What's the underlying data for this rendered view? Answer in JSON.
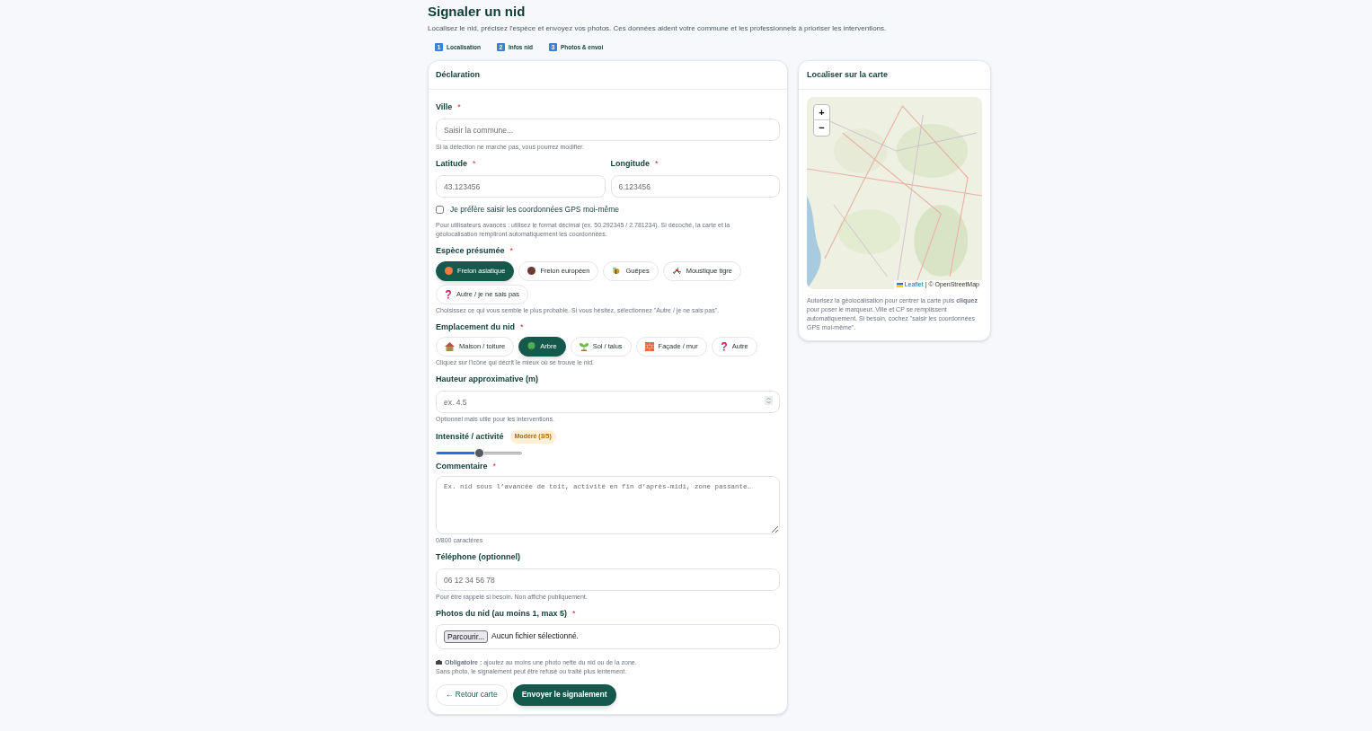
{
  "page": {
    "title": "Signaler un nid",
    "subtitle": "Localisez le nid, précisez l'espèce et envoyez vos photos. Ces données aident votre commune et les professionnels à prioriser les interventions."
  },
  "steps": [
    {
      "number": "1",
      "label": "Localisation"
    },
    {
      "number": "2",
      "label": "Infos nid"
    },
    {
      "number": "3",
      "label": "Photos & envoi"
    }
  ],
  "form": {
    "title": "Déclaration",
    "fields": [
      {
        "kind": "text",
        "label": "Ville",
        "required_mark": "*",
        "placeholder": "Saisir la commune...",
        "hint": "Si la détection ne marche pas, vous pourrez modifier."
      },
      {
        "kind": "pair",
        "fields": [
          {
            "label": "Latitude",
            "required_mark": "*",
            "placeholder": "43.123456"
          },
          {
            "label": "Longitude",
            "required_mark": "*",
            "placeholder": "6.123456"
          }
        ]
      },
      {
        "kind": "checkbox",
        "label": "Je préfère saisir les coordonnées GPS moi-même",
        "checked": false,
        "hint": "Pour utilisateurs avancés : utilisez le format décimal (ex. 50.292345 / 2.781234). Si décoché, la carte et la géolocalisation rempliront automatiquement les coordonnées."
      },
      {
        "kind": "chips",
        "label": "Espèce présumée",
        "required_mark": "*",
        "options": [
          {
            "label": "Frelon asiatique",
            "selected": true
          },
          {
            "label": "Frelon européen",
            "selected": false
          },
          {
            "label": "Guêpes",
            "selected": false
          },
          {
            "label": "Moustique tigre",
            "selected": false
          },
          {
            "label": "Autre / je ne sais pas",
            "selected": false
          }
        ],
        "hint": "Choisissez ce qui vous semble le plus probable. Si vous hésitez, sélectionnez \"Autre / je ne sais pas\"."
      },
      {
        "kind": "chips",
        "label": "Emplacement du nid",
        "required_mark": "*",
        "options": [
          {
            "label": "Maison / toiture",
            "selected": false
          },
          {
            "label": "Arbre",
            "selected": true
          },
          {
            "label": "Sol / talus",
            "selected": false
          },
          {
            "label": "Façade / mur",
            "selected": false
          },
          {
            "label": "Autre",
            "selected": false
          }
        ],
        "hint": "Cliquez sur l'icône qui décrit le mieux où se trouve le nid."
      },
      {
        "kind": "number",
        "label": "Hauteur approximative (m)",
        "placeholder": "ex. 4.5",
        "hint": "Optionnel mais utile pour les interventions."
      },
      {
        "kind": "slider",
        "label": "Intensité / activité",
        "badge": "Modéré (3/5)",
        "level": 0.5
      },
      {
        "kind": "textarea",
        "label": "Commentaire",
        "required_mark": "*",
        "placeholder": "Ex. nid sous l’avancée de toit, activité en fin d’après-midi, zone passante…",
        "hint": "0/800 caractères"
      },
      {
        "kind": "text",
        "label": "Téléphone (optionnel)",
        "placeholder": "06 12 34 56 78",
        "hint": "Pour être rappelé si besoin. Non affiché publiquement."
      },
      {
        "kind": "file",
        "label": "Photos du nid (au moins 1, max 5)",
        "required_mark": "*",
        "button": "Parcourir...",
        "status": "Aucun fichier sélectionné."
      }
    ],
    "notice": [
      "**Obligatoire :** ajoutez au moins une photo nette du nid ou de la zone.",
      "Sans photo, le signalement peut être refusé ou traité plus lentement."
    ],
    "actions": [
      {
        "kind": "secondary",
        "label": "← Retour carte"
      },
      {
        "kind": "primary",
        "label": "Envoyer le signalement"
      }
    ]
  },
  "map_panel": {
    "title": "Localiser sur la carte",
    "zoom": [
      "+",
      "−"
    ],
    "attribution": {
      "link": "Leaflet",
      "text": "| © OpenStreetMap"
    },
    "note": "Autorisez la géolocalisation pour centrer la carte puis **cliquez** pour poser le marqueur. Ville et CP se remplissent automatiquement. Si besoin, cochez \"saisir les coordonnées GPS moi-même\"."
  }
}
